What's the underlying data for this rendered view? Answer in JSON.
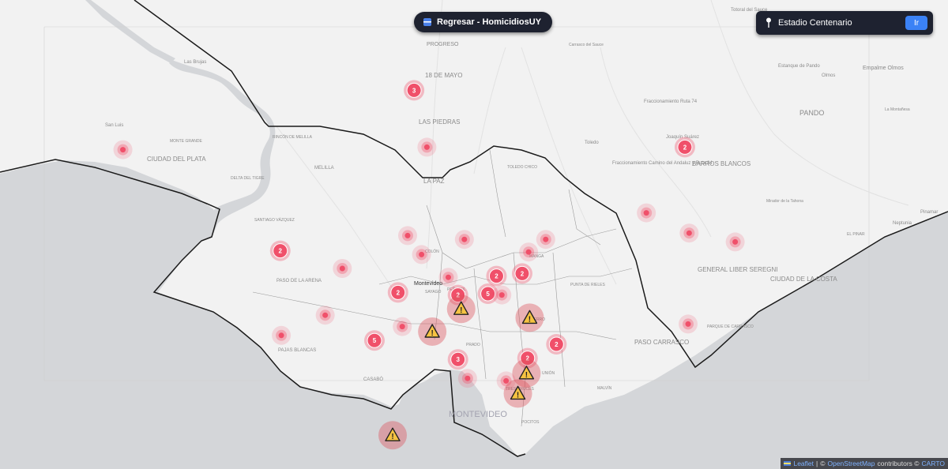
{
  "header": {
    "back_label": "Regresar - HomicidiosUY"
  },
  "search": {
    "value": "Estadio Centenario",
    "button_label": "Ir"
  },
  "attribution": {
    "leaflet": "Leaflet",
    "sep": "|",
    "copy1": "©",
    "osm": "OpenStreetMap",
    "contributors": "contributors ©",
    "carto": "CARTO"
  },
  "colors": {
    "land": "#f2f2f2",
    "water": "#d4d6d9",
    "cluster": "#f0506a",
    "boundary": "#1a1a1a",
    "warning": "#f5c242"
  },
  "icons": {
    "back": "flag-icon",
    "location": "map-pin-icon",
    "warning": "warning-triangle-icon"
  },
  "labels": {
    "progreso": "PROGRESO",
    "dieciocho_mayo": "18 DE MAYO",
    "las_piedras": "LAS PIEDRAS",
    "la_paz": "LA PAZ",
    "toledo_chico": "TOLEDO CHICO",
    "toledo": "Toledo",
    "carrasco_sauce": "Carrasco del Sauce",
    "totoral": "Totoral del Sauce",
    "estanque": "Estanque de Pando",
    "empalme": "Empalme Olmos",
    "olmos": "Olmos",
    "pando": "PANDO",
    "la_montanesa": "La Montañesa",
    "fracc74": "Fraccionamiento Ruta 74",
    "joaquin": "Joaquín Suárez",
    "fracc_camino": "Fraccionamiento Camino del Andaluz y Ruta 84",
    "barros_blancos": "BARROS BLANCOS",
    "mirador": "Mirador de la Tahona",
    "el_pinar": "EL PINAR",
    "neptunia": "Neptunia",
    "pinamar": "Pinamar",
    "general_liber": "GENERAL LIBER SEREGNI",
    "ciudad_costa": "CIUDAD DE LA COSTA",
    "parque_carrasco": "PARQUE DE CARRASCO",
    "paso_carrasco": "PASO CARRASCO",
    "ciudad_plata": "CIUDAD DEL PLATA",
    "monte_grande": "MONTE GRANDE",
    "san_luis": "San Luis",
    "las_brujas": "Las Brujas",
    "rincon_melilla": "RINCÓN DE MELILLA",
    "melilla": "MELILLA",
    "santiago_vazquez": "SANTIAGO VÁZQUEZ",
    "delta_tigre": "DELTA DEL TIGRE",
    "paso_arena": "PASO DE LA ARENA",
    "pajas_blancas": "PAJAS BLANCAS",
    "casabo": "CASABÓ",
    "montevideo_small": "Montevideo",
    "montevideo_big": "MONTEVIDEO",
    "sayago": "SAYAGO",
    "penarol": "PEÑAROL",
    "manga": "MANGA",
    "punta_rieles": "PUNTA DE RIELES",
    "union": "UNIÓN",
    "maldonado": "MALVÍN",
    "pocitos": "POCITOS",
    "tres_cruces": "TRES CRUCES",
    "cerro": "CERRO",
    "prado": "PRADO",
    "colon": "COLÓN"
  },
  "clusters": [
    {
      "kind": "cluster",
      "count": "3",
      "lat": -34.725,
      "lon": -56.22
    },
    {
      "kind": "point",
      "lat": -34.77,
      "lon": -56.208
    },
    {
      "kind": "point",
      "lat": -34.772,
      "lon": -56.492
    },
    {
      "kind": "cluster",
      "count": "2",
      "lat": -34.77,
      "lon": -55.967
    },
    {
      "kind": "point",
      "lat": -34.822,
      "lon": -56.003
    },
    {
      "kind": "point",
      "lat": -34.838,
      "lon": -55.963
    },
    {
      "kind": "point",
      "lat": -34.845,
      "lon": -55.92
    },
    {
      "kind": "point",
      "lat": -34.84,
      "lon": -56.226
    },
    {
      "kind": "point",
      "lat": -34.843,
      "lon": -56.173
    },
    {
      "kind": "point",
      "lat": -34.843,
      "lon": -56.097
    },
    {
      "kind": "cluster",
      "count": "2",
      "lat": -34.852,
      "lon": -56.345
    },
    {
      "kind": "point",
      "lat": -34.855,
      "lon": -56.213
    },
    {
      "kind": "point",
      "lat": -34.853,
      "lon": -56.113
    },
    {
      "kind": "point",
      "lat": -34.866,
      "lon": -56.287
    },
    {
      "kind": "point",
      "lat": -34.873,
      "lon": -56.188
    },
    {
      "kind": "cluster",
      "count": "2",
      "lat": -34.872,
      "lon": -56.143
    },
    {
      "kind": "cluster",
      "count": "2",
      "lat": -34.87,
      "lon": -56.119
    },
    {
      "kind": "cluster",
      "count": "2",
      "lat": -34.885,
      "lon": -56.235
    },
    {
      "kind": "cluster",
      "count": "2",
      "lat": -34.887,
      "lon": -56.179
    },
    {
      "kind": "cluster",
      "count": "5",
      "lat": -34.886,
      "lon": -56.151
    },
    {
      "kind": "point",
      "lat": -34.887,
      "lon": -56.138
    },
    {
      "kind": "point",
      "lat": -34.903,
      "lon": -56.303
    },
    {
      "kind": "point",
      "lat": -34.912,
      "lon": -56.231
    },
    {
      "kind": "warning",
      "lat": -34.898,
      "lon": -56.176
    },
    {
      "kind": "warning",
      "lat": -34.905,
      "lon": -56.112
    },
    {
      "kind": "warning",
      "lat": -34.916,
      "lon": -56.203
    },
    {
      "kind": "point",
      "lat": -34.919,
      "lon": -56.344
    },
    {
      "kind": "cluster",
      "count": "5",
      "lat": -34.923,
      "lon": -56.257
    },
    {
      "kind": "cluster",
      "count": "2",
      "lat": -34.926,
      "lon": -56.087
    },
    {
      "kind": "point",
      "lat": -34.91,
      "lon": -55.964
    },
    {
      "kind": "cluster",
      "count": "3",
      "lat": -34.938,
      "lon": -56.179
    },
    {
      "kind": "cluster",
      "count": "2",
      "lat": -34.937,
      "lon": -56.114
    },
    {
      "kind": "warning",
      "lat": -34.949,
      "lon": -56.115
    },
    {
      "kind": "point",
      "lat": -34.953,
      "lon": -56.17
    },
    {
      "kind": "point",
      "lat": -34.955,
      "lon": -56.134
    },
    {
      "kind": "warning",
      "lat": -34.965,
      "lon": -56.123
    },
    {
      "kind": "warning",
      "lat": -34.998,
      "lon": -56.24
    }
  ]
}
